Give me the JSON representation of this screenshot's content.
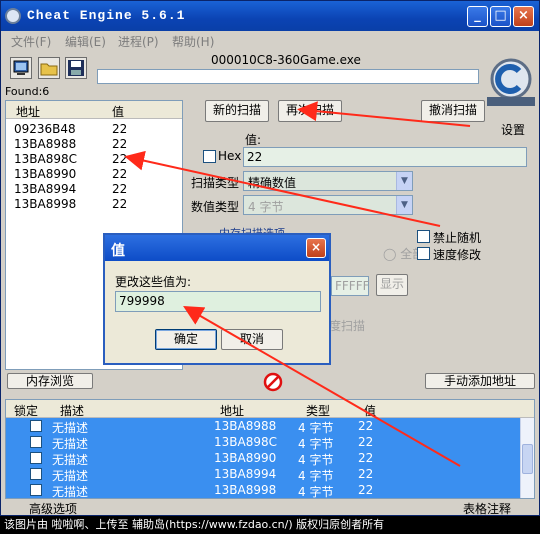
{
  "window": {
    "title": "Cheat Engine 5.6.1"
  },
  "menu": [
    "文件(F)",
    "编辑(E)",
    "进程(P)",
    "帮助(H)"
  ],
  "process_name": "000010C8-360Game.exe",
  "found_label": "Found:6",
  "address_list": {
    "headers": [
      "地址",
      "值"
    ],
    "rows": [
      {
        "addr": "09236B48",
        "val": "22"
      },
      {
        "addr": "13BA8988",
        "val": "22"
      },
      {
        "addr": "13BA898C",
        "val": "22"
      },
      {
        "addr": "13BA8990",
        "val": "22"
      },
      {
        "addr": "13BA8994",
        "val": "22"
      },
      {
        "addr": "13BA8998",
        "val": "22"
      }
    ]
  },
  "scan": {
    "new_scan": "新的扫描",
    "next_scan": "再次扫描",
    "undo_scan": "撤消扫描",
    "settings": "设置",
    "value_label": "值:",
    "hex_label": "Hex",
    "value_input": "22",
    "scan_type_label": "扫描类型",
    "scan_type_value": "精确数值",
    "value_type_label": "数值类型",
    "value_type_value": "4 字节",
    "options_label": "内存扫描选项",
    "all_label": "全部",
    "hex_ffff": "FFFFF",
    "show_btn": "显示",
    "fast_scan": "度扫描",
    "disable_random": "禁止随机",
    "speed_modify": "速度修改"
  },
  "dialog": {
    "title": "值",
    "prompt": "更改这些值为:",
    "input": "799998",
    "ok": "确定",
    "cancel": "取消"
  },
  "bottom_buttons": {
    "memory_view": "内存浏览",
    "add_manual": "手动添加地址"
  },
  "cheat_table": {
    "headers": [
      "锁定",
      "描述",
      "地址",
      "类型",
      "值"
    ],
    "rows": [
      {
        "desc": "无描述",
        "addr": "13BA8988",
        "type": "4 字节",
        "val": "22"
      },
      {
        "desc": "无描述",
        "addr": "13BA898C",
        "type": "4 字节",
        "val": "22"
      },
      {
        "desc": "无描述",
        "addr": "13BA8990",
        "type": "4 字节",
        "val": "22"
      },
      {
        "desc": "无描述",
        "addr": "13BA8994",
        "type": "4 字节",
        "val": "22"
      },
      {
        "desc": "无描述",
        "addr": "13BA8998",
        "type": "4 字节",
        "val": "22"
      }
    ]
  },
  "status": {
    "advanced": "高级选项",
    "table_notes": "表格注释"
  },
  "caption": "该图片由 啦啦啊、上传至 辅助岛(https://www.fzdao.cn/) 版权归原创者所有",
  "colors": {
    "accent": "#3a8ff0",
    "annotation_arrow": "#ff2a1a",
    "title_blue": "#0b43b3"
  }
}
